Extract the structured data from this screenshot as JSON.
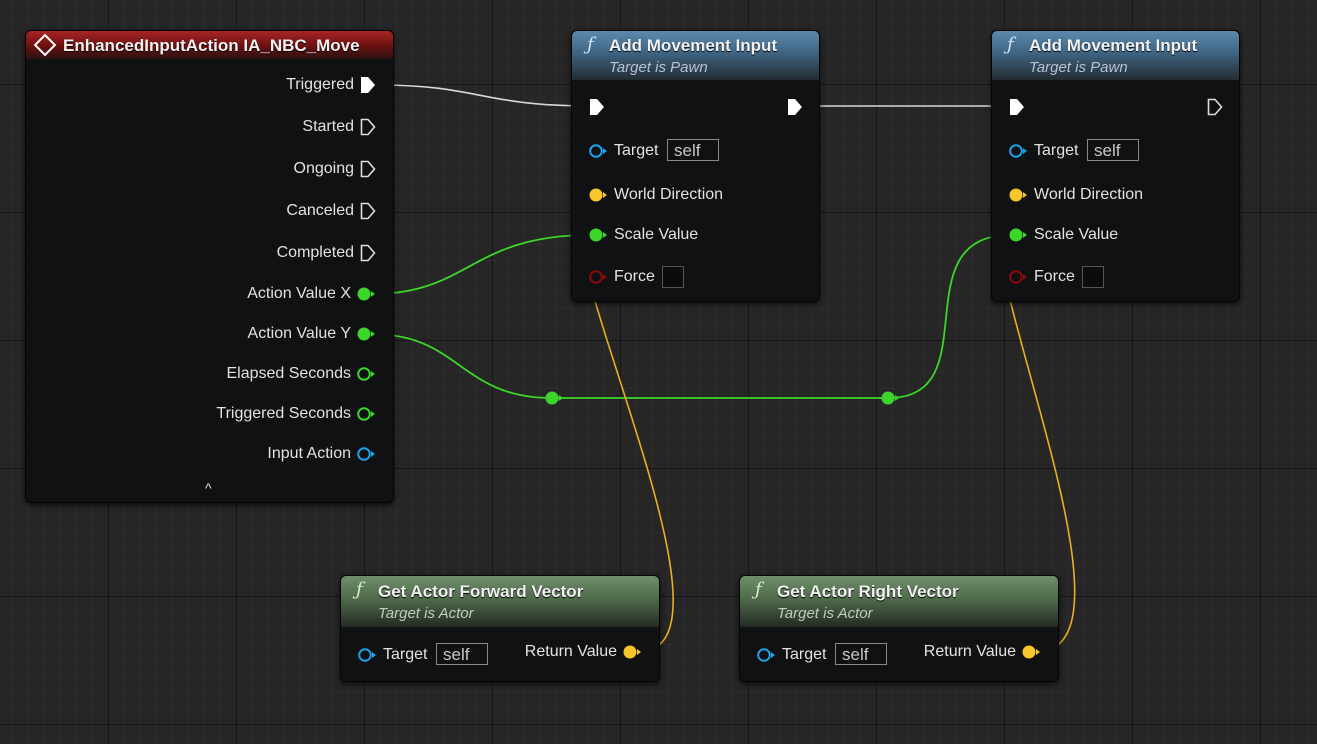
{
  "event_node": {
    "title": "EnhancedInputAction IA_NBC_Move",
    "pins": {
      "triggered": "Triggered",
      "started": "Started",
      "ongoing": "Ongoing",
      "canceled": "Canceled",
      "completed": "Completed",
      "action_value_x": "Action Value X",
      "action_value_y": "Action Value Y",
      "elapsed_seconds": "Elapsed Seconds",
      "triggered_seconds": "Triggered Seconds",
      "input_action": "Input Action"
    },
    "collapse_glyph": "^"
  },
  "add_movement_1": {
    "title": "Add Movement Input",
    "subtitle": "Target is Pawn",
    "target_label": "Target",
    "target_value": "self",
    "world_direction_label": "World Direction",
    "scale_value_label": "Scale Value",
    "force_label": "Force"
  },
  "add_movement_2": {
    "title": "Add Movement Input",
    "subtitle": "Target is Pawn",
    "target_label": "Target",
    "target_value": "self",
    "world_direction_label": "World Direction",
    "scale_value_label": "Scale Value",
    "force_label": "Force"
  },
  "get_forward": {
    "title": "Get Actor Forward Vector",
    "subtitle": "Target is Actor",
    "target_label": "Target",
    "target_value": "self",
    "return_label": "Return Value"
  },
  "get_right": {
    "title": "Get Actor Right Vector",
    "subtitle": "Target is Actor",
    "target_label": "Target",
    "target_value": "self",
    "return_label": "Return Value"
  },
  "icons": {
    "function": "ƒ",
    "event": "event-diamond-icon"
  },
  "colors": {
    "exec": "#ffffff",
    "float": "#3cd62a",
    "vector": "#f7c52c",
    "object": "#1aa3e8",
    "bool": "#8a0b0b",
    "event_header": "#a82424",
    "function_header": "#4a7494",
    "pure_function_header": "#5e7d59"
  }
}
